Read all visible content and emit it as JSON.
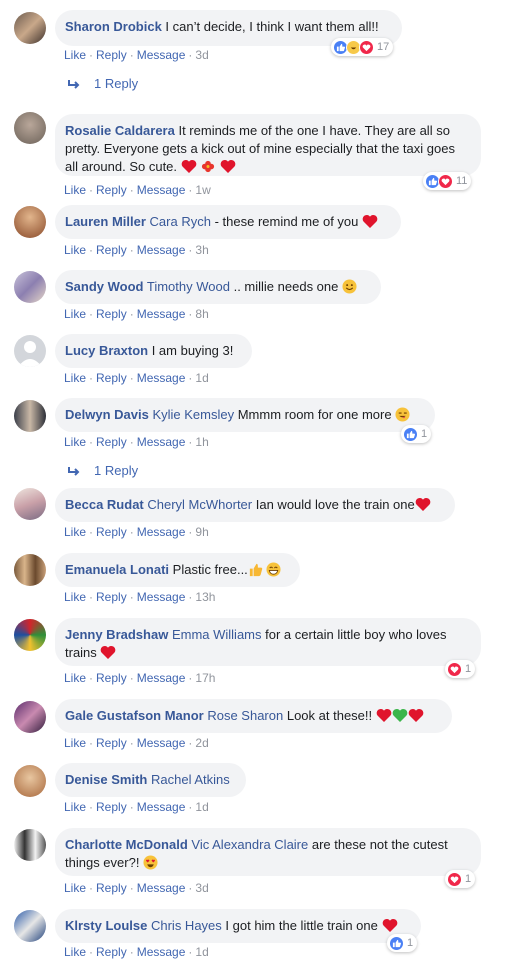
{
  "actions": {
    "like": "Like",
    "reply": "Reply",
    "message": "Message",
    "sep": "·"
  },
  "colors": {
    "link": "#385898",
    "bubble": "#f2f3f5",
    "like": "#4a80f5",
    "love": "#f0284a"
  },
  "comments": [
    {
      "author": "Sharon Drobick",
      "tag": "",
      "text": "I can’t decide, I think I want them all!!",
      "time": "3d",
      "reactions": [
        "like",
        "haha",
        "love"
      ],
      "reaction_count": "17",
      "replies": "1 Reply",
      "emojis": []
    },
    {
      "author": "Rosalie Caldarera",
      "tag": "",
      "text": "It reminds me of the one I have. They are all so pretty. Everyone gets a kick out of mine especially that the taxi goes all around. So cute.",
      "time": "1w",
      "reactions": [
        "like",
        "love"
      ],
      "reaction_count": "11",
      "replies": "",
      "emojis": [
        "heart",
        "flower",
        "heart"
      ]
    },
    {
      "author": "Lauren Miller",
      "tag": "Cara Rych",
      "text": "- these remind me of you",
      "time": "3h",
      "reactions": [],
      "reaction_count": "",
      "replies": "",
      "emojis": [
        "heart"
      ]
    },
    {
      "author": "Sandy Wood",
      "tag": "Timothy Wood",
      "text": ".. millie needs one",
      "time": "8h",
      "reactions": [],
      "reaction_count": "",
      "replies": "",
      "emojis": [
        "smile"
      ]
    },
    {
      "author": "Lucy Braxton",
      "tag": "",
      "text": "I am buying 3!",
      "time": "1d",
      "reactions": [],
      "reaction_count": "",
      "replies": "",
      "emojis": []
    },
    {
      "author": "Delwyn Davis",
      "tag": "Kylie Kemsley",
      "text": "Mmmm room for one more",
      "time": "1h",
      "reactions": [
        "like"
      ],
      "reaction_count": "1",
      "replies": "1 Reply",
      "emojis": [
        "wink"
      ]
    },
    {
      "author": "Becca Rudat",
      "tag": "Cheryl McWhorter",
      "text": "Ian would love the train one",
      "time": "9h",
      "reactions": [],
      "reaction_count": "",
      "replies": "",
      "emojis": [
        "heart"
      ]
    },
    {
      "author": "Emanuela Lonati",
      "tag": "",
      "text": "Plastic free...",
      "time": "13h",
      "reactions": [],
      "reaction_count": "",
      "replies": "",
      "emojis": [
        "thumbs",
        "grin"
      ]
    },
    {
      "author": "Jenny Bradshaw",
      "tag": "Emma Williams",
      "text": "for a certain little boy who loves trains",
      "time": "17h",
      "reactions": [
        "love"
      ],
      "reaction_count": "1",
      "replies": "",
      "emojis": [
        "heart"
      ]
    },
    {
      "author": "Gale Gustafson Manor",
      "tag": "Rose Sharon",
      "text": "Look at these!!",
      "time": "2d",
      "reactions": [],
      "reaction_count": "",
      "replies": "",
      "emojis": [
        "heart",
        "greenheart",
        "heart"
      ]
    },
    {
      "author": "Denise Smith",
      "tag": "Rachel Atkins",
      "text": "",
      "time": "1d",
      "reactions": [],
      "reaction_count": "",
      "replies": "",
      "emojis": []
    },
    {
      "author": "Charlotte McDonald",
      "tag": "Vic Alexandra Claire",
      "text": "are these not the cutest things ever?!",
      "time": "3d",
      "reactions": [
        "love"
      ],
      "reaction_count": "1",
      "replies": "",
      "emojis": [
        "hearteyes"
      ]
    },
    {
      "author": "Klrsty Loulse",
      "tag": "Chris Hayes",
      "text": "I got him the little train one",
      "time": "1d",
      "reactions": [
        "like"
      ],
      "reaction_count": "1",
      "replies": "",
      "emojis": [
        "heart"
      ]
    }
  ]
}
